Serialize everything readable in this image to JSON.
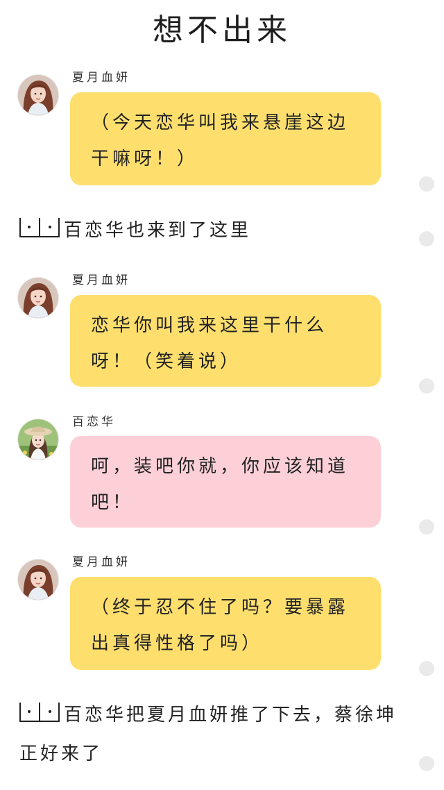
{
  "page": {
    "title": "想不出来"
  },
  "messages": [
    {
      "sender": "夏月血妍",
      "avatar_icon": "avatar-girl-long-hair",
      "bubble_color": "#fedf6e",
      "text": "（今天恋华叫我来悬崖这边干嘛呀！）"
    },
    {
      "sender": "夏月血妍",
      "avatar_icon": "avatar-girl-long-hair",
      "bubble_color": "#fedf6e",
      "text": "恋华你叫我来这里干什么呀！（笑着说）"
    },
    {
      "sender": "百恋华",
      "avatar_icon": "avatar-girl-hat",
      "bubble_color": "#fdd0d8",
      "text": "呵，装吧你就，你应该知道吧！"
    },
    {
      "sender": "夏月血妍",
      "avatar_icon": "avatar-girl-long-hair",
      "bubble_color": "#fedf6e",
      "text": "（终于忍不住了吗？要暴露出真得性格了吗）"
    }
  ],
  "narrations": [
    {
      "marker_icon": "narration-marker-icon",
      "text": "百恋华也来到了这里"
    },
    {
      "marker_icon": "narration-marker-icon",
      "text": "百恋华把夏月血妍推了下去，蔡徐坤正好来了"
    }
  ],
  "colors": {
    "yellow_bubble": "#fedf6e",
    "pink_bubble": "#fdd0d8",
    "side_dot": "#eaeaea"
  }
}
